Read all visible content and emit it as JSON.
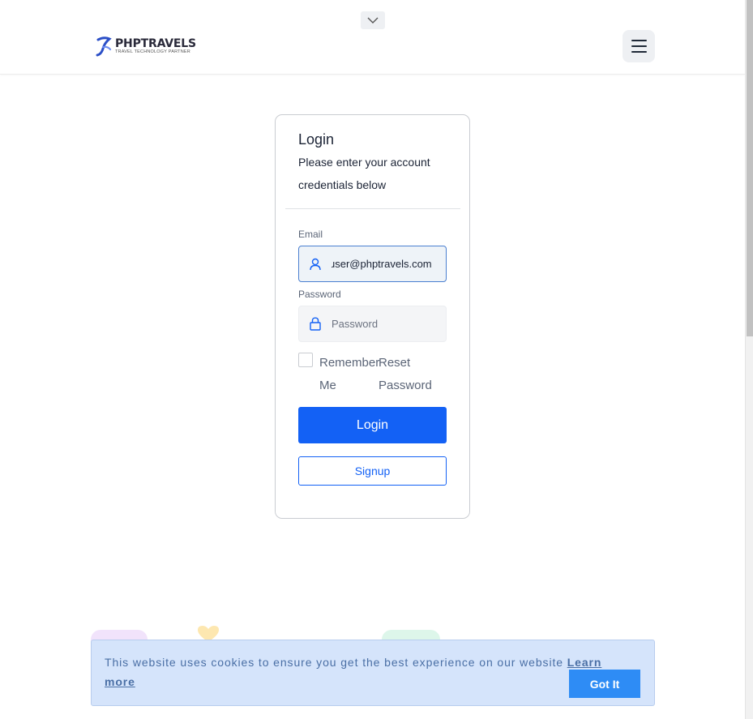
{
  "brand": {
    "name": "PHPTRAVELS",
    "tagline": "TRAVEL TECHNOLOGY PARTNER"
  },
  "header": {
    "collapse_icon": "chevron-down-icon",
    "menu_icon": "hamburger-menu-icon"
  },
  "login": {
    "title": "Login",
    "subtitle": "Please enter your account credentials below",
    "email_label": "Email",
    "email_value": "user@phptravels.com",
    "email_icon": "user-icon",
    "password_label": "Password",
    "password_placeholder": "Password",
    "password_icon": "lock-icon",
    "remember_label": "Remember Me",
    "reset_label": "Reset Password",
    "login_button": "Login",
    "signup_button": "Signup"
  },
  "cookie": {
    "text": "This website uses cookies to ensure you get the best experience on our website ",
    "learn_more": "Learn more",
    "button": "Got It"
  },
  "colors": {
    "primary": "#1361f5",
    "cookie_bg": "#d5e4fb",
    "cookie_button": "#2e8cf5"
  }
}
